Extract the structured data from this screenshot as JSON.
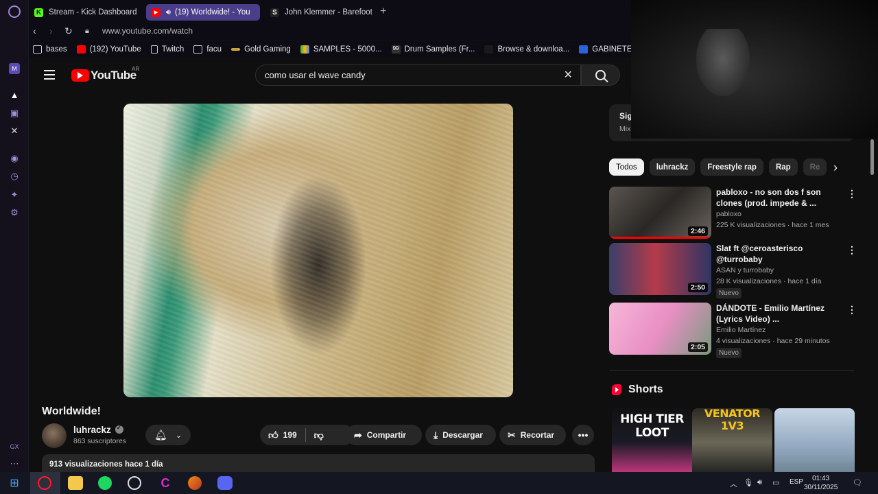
{
  "browser": {
    "tabs": [
      {
        "label": "Stream - Kick Dashboard",
        "active": false
      },
      {
        "label": "(19) Worldwide! - You",
        "active": true
      },
      {
        "label": "John Klemmer - Barefoot",
        "active": false
      }
    ],
    "url": "www.youtube.com/watch",
    "bookmarks": [
      {
        "label": "bases",
        "icon": "folder-icon"
      },
      {
        "label": "(192) YouTube",
        "icon": "youtube-icon"
      },
      {
        "label": "Twitch",
        "icon": "page-icon"
      },
      {
        "label": "facu",
        "icon": "folder-icon"
      },
      {
        "label": "Gold Gaming",
        "icon": "gold-gaming-icon"
      },
      {
        "label": "SAMPLES - 5000...",
        "icon": "drive-icon"
      },
      {
        "label": "Drum Samples (Fr...",
        "icon": "99-icon"
      },
      {
        "label": "Browse & downloa...",
        "icon": "page-icon"
      },
      {
        "label": "GABINETE",
        "icon": "gabinete-icon"
      }
    ]
  },
  "youtube": {
    "logo_text": "YouTube",
    "country": "AR",
    "search_value": "como usar el wave candy",
    "video": {
      "title": "Worldwide!",
      "channel": "luhrackz",
      "subscribers": "863 suscriptores",
      "likes": "199",
      "share": "Compartir",
      "download": "Descargar",
      "clip": "Recortar",
      "views": "913 visualizaciones  hace 1 día"
    },
    "mix": {
      "title": "Sig",
      "subtitle": "Mix"
    },
    "chips": [
      "Todos",
      "luhrackz",
      "Freestyle rap",
      "Rap",
      "Re"
    ],
    "recommendations": [
      {
        "title": "pabloxo - no son dos f son clones (prod. impede & ...",
        "channel": "pabloxo",
        "meta": "225 K visualizaciones · hace 1 mes",
        "duration": "2:46",
        "badge": ""
      },
      {
        "title": "Slat ft @ceroasterisco @turrobaby",
        "channel": "ASAN  y turrobaby",
        "meta": "28 K visualizaciones · hace 1 día",
        "duration": "2:50",
        "badge": "Nuevo"
      },
      {
        "title": "DÁNDOTE - Emilio Martínez (Lyrics Video) ...",
        "channel": "Emilio Martínez",
        "meta": "4 visualizaciones · hace 29 minutos",
        "duration": "2:05",
        "badge": "Nuevo"
      }
    ],
    "shorts_heading": "Shorts",
    "shorts": [
      {
        "text": "HIGH TIER LOOT"
      },
      {
        "text": "VENATOR 1V3"
      },
      {
        "text": ""
      }
    ]
  },
  "taskbar": {
    "language": "ESP",
    "time": "01:43",
    "date": "30/11/2025"
  }
}
